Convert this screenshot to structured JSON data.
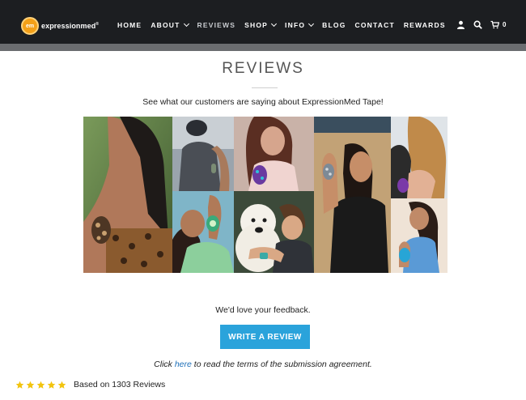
{
  "brand": {
    "badge": "em",
    "name": "expressionmed",
    "reg": "®"
  },
  "nav": [
    {
      "label": "HOME",
      "dropdown": false,
      "active": false
    },
    {
      "label": "ABOUT",
      "dropdown": true,
      "active": false
    },
    {
      "label": "REVIEWS",
      "dropdown": false,
      "active": true
    },
    {
      "label": "SHOP",
      "dropdown": true,
      "active": false
    },
    {
      "label": "INFO",
      "dropdown": true,
      "active": false
    },
    {
      "label": "BLOG",
      "dropdown": false,
      "active": false
    },
    {
      "label": "CONTACT",
      "dropdown": false,
      "active": false
    },
    {
      "label": "REWARDS",
      "dropdown": false,
      "active": false
    }
  ],
  "header_icons": [
    "user-icon",
    "search-icon",
    "cart-icon"
  ],
  "cart_count": "0",
  "main": {
    "title": "REVIEWS",
    "subtitle": "See what our customers are saying about ExpressionMed Tape!",
    "feedback": "We'd love your feedback.",
    "button_label": "WRITE A REVIEW",
    "terms_before": "Click ",
    "terms_link": "here",
    "terms_after": " to read the terms of the submission agreement."
  },
  "rating": {
    "stars": 5,
    "text": "Based on 1303 Reviews"
  },
  "colors": {
    "header_bg": "#1c1e21",
    "accent": "#2aa3db",
    "star": "#f2c40f",
    "link": "#1d6fb8"
  }
}
